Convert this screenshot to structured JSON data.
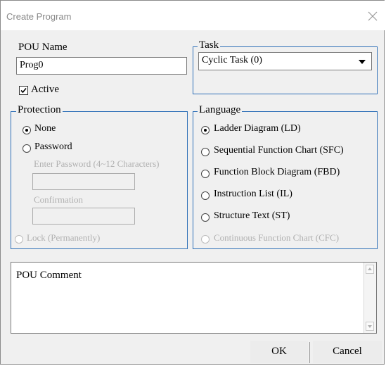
{
  "window": {
    "title": "Create Program"
  },
  "pou": {
    "name_label": "POU Name",
    "name_value": "Prog0",
    "active_label": "Active",
    "active_checked": true
  },
  "task": {
    "legend": "Task",
    "selected": "Cyclic Task (0)"
  },
  "protection": {
    "legend": "Protection",
    "none_label": "None",
    "password_label": "Password",
    "enter_password_label": "Enter Password (4~12 Characters)",
    "confirmation_label": "Confirmation",
    "lock_label": "Lock (Permanently)",
    "selected": "None"
  },
  "language": {
    "legend": "Language",
    "options": [
      "Ladder Diagram (LD)",
      "Sequential Function Chart (SFC)",
      "Function Block Diagram (FBD)",
      "Instruction List (IL)",
      "Structure Text (ST)",
      "Continuous Function Chart (CFC)"
    ],
    "selected": "Ladder Diagram (LD)"
  },
  "comment": {
    "label": "POU Comment"
  },
  "buttons": {
    "ok": "OK",
    "cancel": "Cancel"
  }
}
